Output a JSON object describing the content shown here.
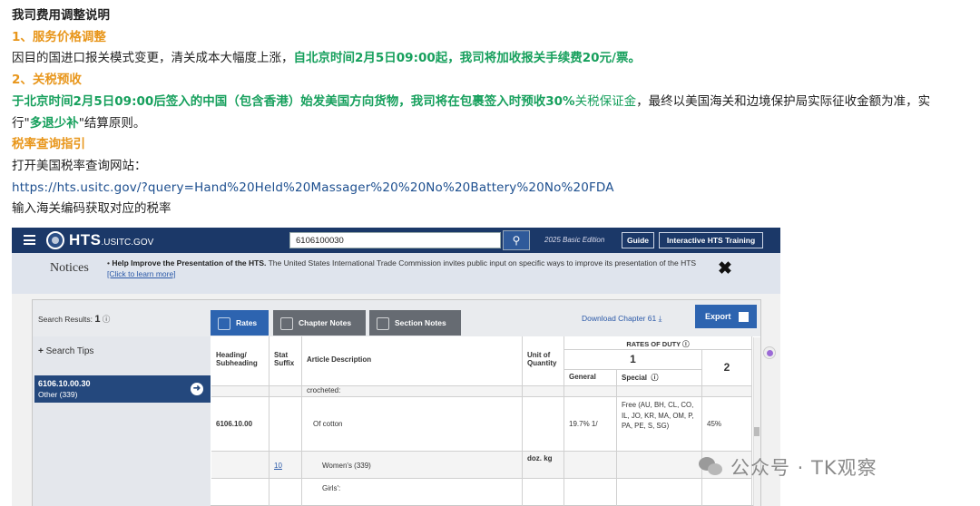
{
  "article": {
    "title": "我司费用调整说明",
    "s1_heading": "1、服务价格调整",
    "s1_text_plain": "因目的国进口报关模式变更，清关成本大幅度上涨，",
    "s1_text_green": "自北京时间2月5日09:00起，我司将加收报关手续费20元/票。",
    "s2_heading": "2、关税预收",
    "s2_green_bold": "于北京时间2月5日09:00后签入的中国（包含香港）始发美国方向货物，我司将在包裹签入时预收30%",
    "s2_green_normal": "关税保证金",
    "s2_plain": "，最终以美国海关和边境保护局实际征收金额为准，实",
    "s2_line2_a": "行\"",
    "s2_line2_green": "多退少补",
    "s2_line2_b": "\"结算原则。",
    "s3_heading": "税率查询指引",
    "s3_line1": "打开美国税率查询网站：",
    "s3_link": "https://hts.usitc.gov/?query=Hand%20Held%20Massager%20%20No%20Battery%20No%20FDA",
    "s3_line3": "输入海关编码获取对应的税率"
  },
  "hts": {
    "logo": "HTS",
    "logo_suffix": ".USITC.GOV",
    "search_value": "6106100030",
    "edition": "2025 Basic Edition",
    "guide_label": "Guide",
    "training_label": "Interactive HTS Training",
    "notices_label": "Notices",
    "notice_bold": "Help Improve the Presentation of the HTS.",
    "notice_text": " The United States International Trade Commission invites public input on specific ways to improve its presentation of the HTS ",
    "notice_link": "[Click to learn more]",
    "close_glyph": "✖",
    "results_label": "Search Results: ",
    "results_count": "1",
    "tabs": [
      "Rates",
      "Chapter Notes",
      "Section Notes"
    ],
    "download_label": "Download Chapter 61",
    "export_label": "Export",
    "search_tips": "Search Tips",
    "side_code": "6106.10.00.30",
    "side_desc": "Other (339)",
    "headers": {
      "heading": "Heading/ Subheading",
      "stat": "Stat Suffix",
      "desc": "Article Description",
      "unit": "Unit of Quantity",
      "rates": "RATES OF DUTY",
      "col1": "1",
      "general": "General",
      "special": "Special",
      "col2": "2"
    },
    "rows": [
      {
        "desc": "crocheted:"
      },
      {
        "heading": "6106.10.00",
        "desc": "Of cotton",
        "general": "19.7% 1/",
        "special": "Free (AU, BH, CL, CO, IL, JO, KR, MA, OM, P, PA, PE, S, SG)",
        "col2": "45%"
      },
      {
        "stat": "10",
        "desc": "Women's (339)",
        "unit": "doz. kg"
      },
      {
        "desc": "Girls':"
      }
    ]
  },
  "watermark": "公众号 · TK观察"
}
